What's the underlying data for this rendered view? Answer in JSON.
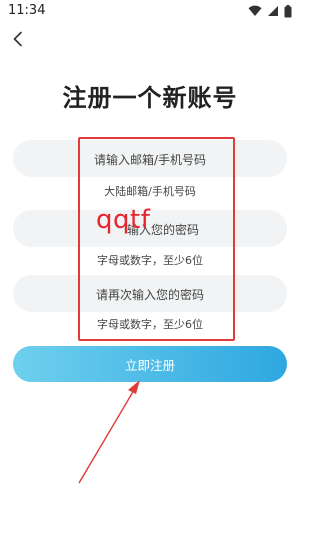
{
  "status_bar": {
    "time": "11:34"
  },
  "page": {
    "title": "注册一个新账号"
  },
  "form": {
    "account_placeholder": "请输入邮箱/手机号码",
    "account_hint": "大陆邮箱/手机号码",
    "password_placeholder": "输入您的密码",
    "password_hint": "字母或数字，至少6位",
    "confirm_placeholder": "请再次输入您的密码",
    "confirm_hint": "字母或数字，至少6位",
    "submit_label": "立即注册"
  },
  "annotation": {
    "overlay_text": "qqtf",
    "color": "#e03a3a"
  },
  "colors": {
    "button_start": "#6fd0ee",
    "button_end": "#2ea7e0",
    "field_bg": "#f1f3f5"
  }
}
